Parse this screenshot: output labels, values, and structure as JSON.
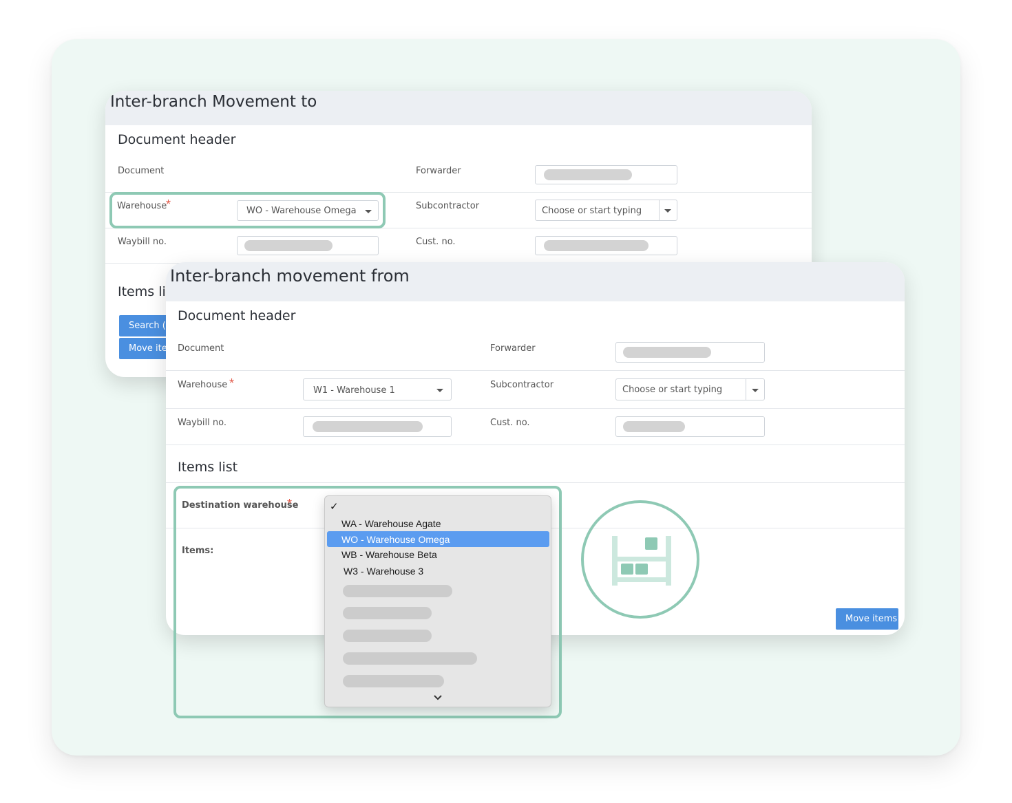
{
  "back_window": {
    "title": "Inter-branch Movement to",
    "section_header": "Document header",
    "labels": {
      "document": "Document",
      "forwarder": "Forwarder",
      "warehouse": "Warehouse",
      "subcontractor": "Subcontractor",
      "waybill": "Waybill no.",
      "cust_no": "Cust. no."
    },
    "required_mark": "*",
    "warehouse_value": "WO - Warehouse Omega",
    "subcontractor_placeholder": "Choose or start typing",
    "items_title": "Items lis",
    "search_button": "Search (F",
    "move_button": "Move iter"
  },
  "front_window": {
    "title": "Inter-branch movement from",
    "section_header": "Document header",
    "labels": {
      "document": "Document",
      "forwarder": "Forwarder",
      "warehouse": "Warehouse",
      "subcontractor": "Subcontractor",
      "waybill": "Waybill no.",
      "cust_no": "Cust. no."
    },
    "required_mark": "*",
    "warehouse_value": "W1 - Warehouse 1",
    "subcontractor_placeholder": "Choose or start typing",
    "items_title": "Items list",
    "destination_label": "Destination warehouse",
    "items_label": "Items:",
    "move_button": "Move items"
  },
  "dropdown": {
    "checkmark": "✓",
    "options": [
      "WA - Warehouse Agate",
      "WO - Warehouse Omega",
      "WB - Warehouse Beta",
      "W3 - Warehouse 3"
    ],
    "selected_index": 1,
    "more_indicator": "⌄"
  },
  "colors": {
    "accent_green": "#8ec9b4",
    "button_blue": "#4a8fe0",
    "selected_blue": "#5b9cf0",
    "required_red": "#e25b4b"
  },
  "icons": [
    "shelf-icon",
    "caret-down-icon",
    "check-icon",
    "chevron-down-icon"
  ]
}
